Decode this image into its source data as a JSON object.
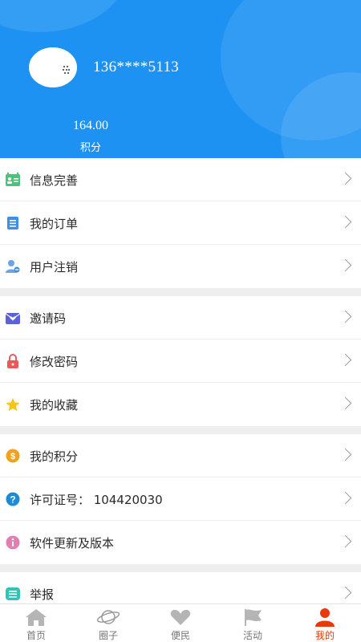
{
  "profile": {
    "phone": "136****5113",
    "points_value": "164.00",
    "points_label": "积分"
  },
  "menu": {
    "section1": [
      {
        "label": "信息完善",
        "icon": "profile-card-icon"
      },
      {
        "label": "我的订单",
        "icon": "order-list-icon"
      },
      {
        "label": "用户注销",
        "icon": "user-cancel-icon"
      }
    ],
    "section2": [
      {
        "label": "邀请码",
        "icon": "envelope-heart-icon"
      },
      {
        "label": "修改密码",
        "icon": "lock-icon"
      },
      {
        "label": "我的收藏",
        "icon": "star-icon"
      }
    ],
    "section3": [
      {
        "label": "我的积分",
        "icon": "coin-icon"
      },
      {
        "label": "许可证号：  104420030",
        "icon": "question-icon"
      },
      {
        "label": "软件更新及版本",
        "icon": "info-icon"
      }
    ],
    "section4": [
      {
        "label": "举报",
        "icon": "report-icon"
      }
    ]
  },
  "tabbar": {
    "tabs": [
      {
        "label": "首页",
        "icon": "home-icon"
      },
      {
        "label": "圈子",
        "icon": "planet-icon"
      },
      {
        "label": "便民",
        "icon": "heart-icon"
      },
      {
        "label": "活动",
        "icon": "flag-icon"
      },
      {
        "label": "我的",
        "icon": "person-icon"
      }
    ],
    "active_index": 4
  },
  "colors": {
    "header": "#1e92f3",
    "active_tab": "#e8390b",
    "tab_inactive_icon": "#b5b5b5"
  }
}
